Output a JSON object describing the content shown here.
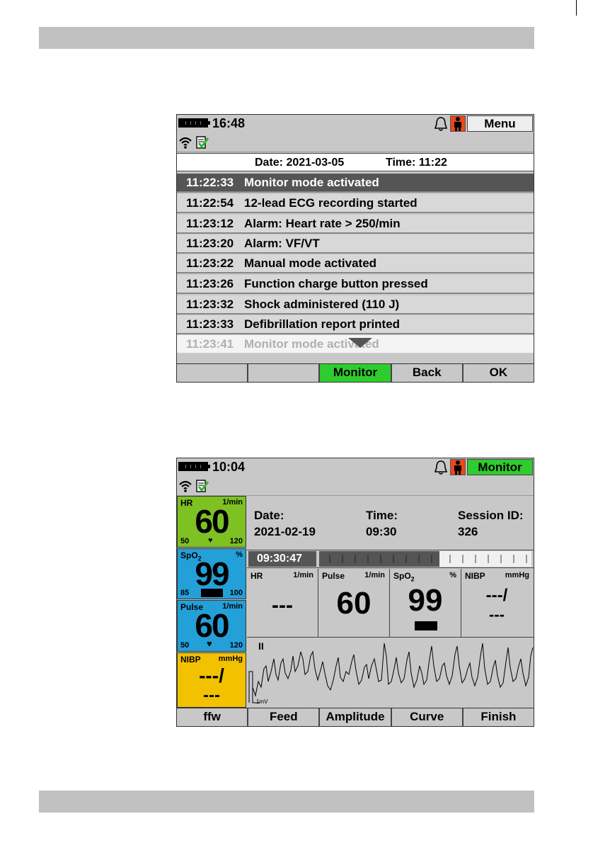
{
  "screen1": {
    "clock": "16:48",
    "menu_label": "Menu",
    "date_label": "Date: 2021-03-05",
    "time_label": "Time: 11:22",
    "events": [
      {
        "time": "11:22:33",
        "text": "Monitor mode activated"
      },
      {
        "time": "11:22:54",
        "text": "12-lead ECG recording started"
      },
      {
        "time": "11:23:12",
        "text": "Alarm: Heart rate > 250/min"
      },
      {
        "time": "11:23:20",
        "text": "Alarm: VF/VT"
      },
      {
        "time": "11:23:22",
        "text": "Manual mode activated"
      },
      {
        "time": "11:23:26",
        "text": "Function charge button pressed"
      },
      {
        "time": "11:23:32",
        "text": "Shock administered (110 J)"
      },
      {
        "time": "11:23:33",
        "text": "Defibrillation report printed"
      },
      {
        "time": "11:23:41",
        "text": "Monitor mode activated"
      }
    ],
    "softkeys": [
      "",
      "",
      "Monitor",
      "Back",
      "OK"
    ]
  },
  "screen2": {
    "clock": "10:04",
    "menu_label": "Monitor",
    "tiles": {
      "hr": {
        "label": "HR",
        "unit": "1/min",
        "value": "60",
        "low": "50",
        "high": "120",
        "color": "#7dc123"
      },
      "spo2": {
        "label": "SpO",
        "sub": "2",
        "unit": "%",
        "value": "99",
        "low": "85",
        "high": "100",
        "color": "#24a0d8"
      },
      "pulse": {
        "label": "Pulse",
        "unit": "1/min",
        "value": "60",
        "low": "50",
        "high": "120",
        "color": "#24a0d8"
      },
      "nibp": {
        "label": "NIBP",
        "unit": "mmHg",
        "value1": "---/",
        "value2": "---",
        "color": "#f2c200"
      }
    },
    "session": {
      "date_label": "Date:",
      "date_value": "2021-02-19",
      "time_label": "Time:",
      "time_value": "09:30",
      "id_label": "Session ID:",
      "id_value": "326"
    },
    "timeline_time": "09:30:47",
    "params": {
      "hr": {
        "label": "HR",
        "unit": "1/min",
        "value": "---"
      },
      "pulse": {
        "label": "Pulse",
        "unit": "1/min",
        "value": "60"
      },
      "spo2": {
        "label": "SpO",
        "sub": "2",
        "unit": "%",
        "value": "99"
      },
      "nibp": {
        "label": "NIBP",
        "unit": "mmHg",
        "value1": "---/",
        "value2": "---"
      }
    },
    "wave": {
      "lead": "II",
      "scale": "1mV"
    },
    "softkeys": [
      "ffw",
      "Feed",
      "Amplitude",
      "Curve",
      "Finish"
    ]
  }
}
